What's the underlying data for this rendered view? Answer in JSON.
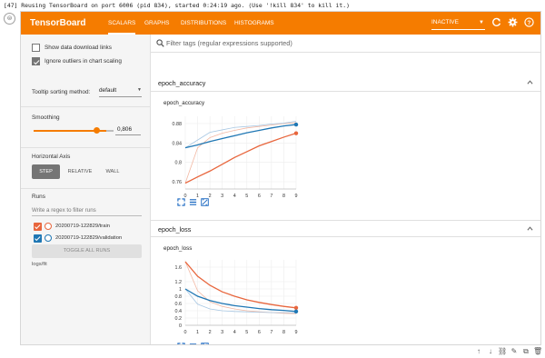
{
  "console": {
    "prompt": "[47]",
    "message": "Reusing TensorBoard on port 6006 (pid 834), started 0:24:19 ago. (Use '!kill 834' to kill it.)"
  },
  "app": {
    "title": "TensorBoard",
    "tabs": [
      {
        "label": "SCALARS",
        "active": true
      },
      {
        "label": "GRAPHS",
        "active": false
      },
      {
        "label": "DISTRIBUTIONS",
        "active": false
      },
      {
        "label": "HISTOGRAMS",
        "active": false
      }
    ],
    "status_select": "INACTIVE",
    "header_icons": [
      "refresh-icon",
      "settings-icon",
      "help-icon"
    ],
    "accent_color": "#f57c00"
  },
  "sidebar": {
    "show_download_label": "Show data download links",
    "show_download_checked": false,
    "ignore_outliers_label": "Ignore outliers in chart scaling",
    "ignore_outliers_checked": true,
    "tooltip_label": "Tooltip sorting method:",
    "tooltip_value": "default",
    "smoothing_label": "Smoothing",
    "smoothing_value": "0,806",
    "smoothing_fraction": 0.806,
    "horizontal_axis_label": "Horizontal Axis",
    "axis_options": [
      {
        "label": "STEP",
        "active": true
      },
      {
        "label": "RELATIVE",
        "active": false
      },
      {
        "label": "WALL",
        "active": false
      }
    ],
    "runs_label": "Runs",
    "runs_filter_placeholder": "Write a regex to filter runs",
    "runs": [
      {
        "name": "20200719-122829/train",
        "color": "#e8663d",
        "checked": true
      },
      {
        "name": "20200719-122829/validation",
        "color": "#1f77b4",
        "checked": true
      }
    ],
    "toggle_all_label": "TOGGLE ALL RUNS",
    "logdir": "logs/fit"
  },
  "main": {
    "filter_placeholder": "Filter tags (regular expressions supported)",
    "sections": [
      {
        "title": "epoch_accuracy",
        "card_title": "epoch_accuracy"
      },
      {
        "title": "epoch_loss",
        "card_title": "epoch_loss"
      }
    ]
  },
  "chart_data": [
    {
      "type": "line",
      "title": "epoch_accuracy",
      "x": [
        0,
        1,
        2,
        3,
        4,
        5,
        6,
        7,
        8,
        9
      ],
      "x_ticks": [
        "0",
        "1",
        "2",
        "3",
        "4",
        "5",
        "6",
        "7",
        "8",
        "9"
      ],
      "y_ticks": [
        "0.76",
        "0.8",
        "0.84",
        "0.88"
      ],
      "ylim": [
        0.745,
        0.895
      ],
      "series": [
        {
          "color": "#e8663d",
          "values": [
            0.757,
            0.77,
            0.782,
            0.796,
            0.81,
            0.822,
            0.834,
            0.843,
            0.852,
            0.86
          ]
        },
        {
          "color": "#1f77b4",
          "values": [
            0.83,
            0.836,
            0.843,
            0.849,
            0.855,
            0.861,
            0.866,
            0.871,
            0.875,
            0.878
          ]
        }
      ],
      "raw_series": [
        {
          "color": "#f2b8a3",
          "values": [
            0.757,
            0.83,
            0.851,
            0.86,
            0.866,
            0.871,
            0.874,
            0.877,
            0.88,
            0.882
          ]
        },
        {
          "color": "#a7c7e3",
          "values": [
            0.83,
            0.846,
            0.862,
            0.867,
            0.872,
            0.874,
            0.876,
            0.879,
            0.881,
            0.885
          ]
        }
      ],
      "grid": true
    },
    {
      "type": "line",
      "title": "epoch_loss",
      "x": [
        0,
        1,
        2,
        3,
        4,
        5,
        6,
        7,
        8,
        9
      ],
      "x_ticks": [
        "0",
        "1",
        "2",
        "3",
        "4",
        "5",
        "6",
        "7",
        "8",
        "9"
      ],
      "y_ticks": [
        "0",
        "0.2",
        "0.4",
        "0.6",
        "0.8",
        "1",
        "1.2",
        "1.6"
      ],
      "ylim": [
        0,
        1.8
      ],
      "series": [
        {
          "color": "#e8663d",
          "values": [
            1.75,
            1.35,
            1.1,
            0.92,
            0.8,
            0.7,
            0.63,
            0.57,
            0.52,
            0.48
          ]
        },
        {
          "color": "#1f77b4",
          "values": [
            1.0,
            0.8,
            0.68,
            0.6,
            0.54,
            0.5,
            0.46,
            0.43,
            0.41,
            0.38
          ]
        }
      ],
      "raw_series": [
        {
          "color": "#f2b8a3",
          "values": [
            1.75,
            0.95,
            0.65,
            0.52,
            0.45,
            0.4,
            0.37,
            0.35,
            0.33,
            0.32
          ]
        },
        {
          "color": "#a7c7e3",
          "values": [
            1.0,
            0.58,
            0.45,
            0.4,
            0.38,
            0.37,
            0.36,
            0.35,
            0.35,
            0.34
          ]
        }
      ],
      "grid": true
    }
  ]
}
